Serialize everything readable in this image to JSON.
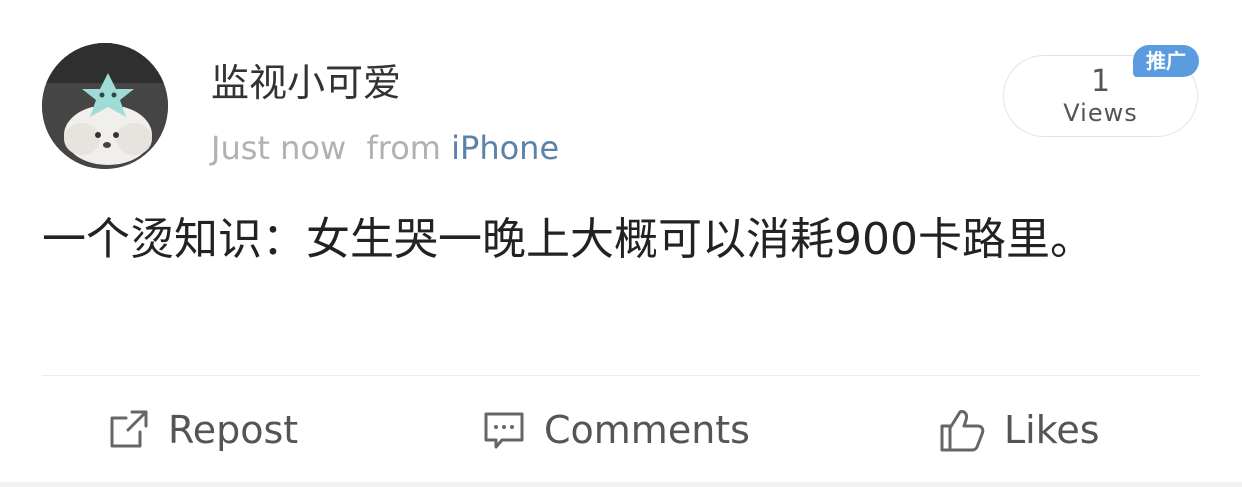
{
  "post": {
    "username": "监视小可爱",
    "time": "Just now",
    "from_label": "from",
    "device": "iPhone",
    "views_count": "1",
    "views_label": "Views",
    "promo_tag": "推广",
    "content": "一个烫知识：女生哭一晚上大概可以消耗900卡路里。"
  },
  "actions": {
    "repost_label": "Repost",
    "comments_label": "Comments",
    "likes_label": "Likes"
  },
  "icons": {
    "repost": "repost-icon",
    "comments": "comment-icon",
    "likes": "thumbs-up-icon"
  },
  "colors": {
    "device_link": "#5b82a8",
    "promo_tag": "#5b9be0",
    "meta_text": "#b1b1b1"
  }
}
